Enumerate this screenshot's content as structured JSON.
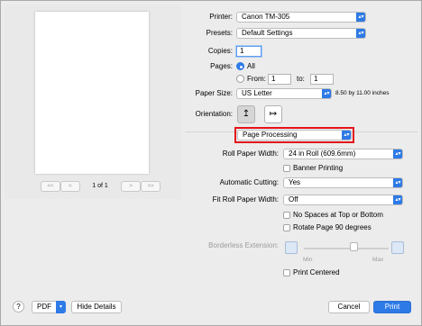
{
  "preview": {
    "pager_first": "<<",
    "pager_prev": "<",
    "page_count": "1 of 1",
    "pager_next": ">",
    "pager_last": ">>"
  },
  "printer": {
    "label": "Printer:",
    "value": "Canon TM-305"
  },
  "presets": {
    "label": "Presets:",
    "value": "Default Settings"
  },
  "copies": {
    "label": "Copies:",
    "value": "1"
  },
  "pages": {
    "label": "Pages:",
    "all": "All",
    "from": "From:",
    "from_value": "1",
    "to": "to:",
    "to_value": "1"
  },
  "paper_size": {
    "label": "Paper Size:",
    "value": "US Letter",
    "dims": "8.50 by 11.00 inches"
  },
  "orientation": {
    "label": "Orientation:"
  },
  "section": {
    "value": "Page Processing"
  },
  "roll_paper_width": {
    "label": "Roll Paper Width:",
    "value": "24 in Roll (609.6mm)"
  },
  "banner_printing": {
    "label": "Banner Printing"
  },
  "automatic_cutting": {
    "label": "Automatic Cutting:",
    "value": "Yes"
  },
  "fit_roll_paper_width": {
    "label": "Fit Roll Paper Width:",
    "value": "Off"
  },
  "no_spaces": {
    "label": "No Spaces at Top or Bottom"
  },
  "rotate_page": {
    "label": "Rotate Page 90 degrees"
  },
  "borderless_extension": {
    "label": "Borderless Extension:",
    "min": "Min",
    "max": "Max"
  },
  "print_centered": {
    "label": "Print Centered"
  },
  "footer": {
    "help": "?",
    "pdf": "PDF",
    "hide_details": "Hide Details",
    "cancel": "Cancel",
    "print": "Print"
  }
}
